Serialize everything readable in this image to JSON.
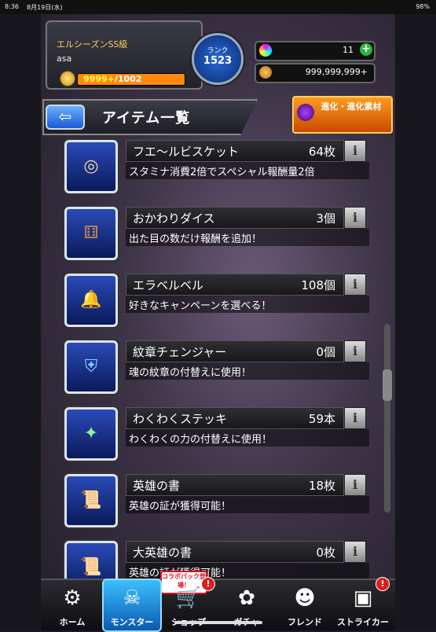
{
  "status": {
    "time": "8:36",
    "date": "8月19日(水)",
    "battery": "98%"
  },
  "header": {
    "season": "エルシーズンSS級",
    "username": "asa",
    "stamina_value": "9999+",
    "stamina_max": "/1002",
    "rank_label": "ランク",
    "rank_number": "1523",
    "orbs": "11",
    "gold": "999,999,999+",
    "plus": "+"
  },
  "titlebar": {
    "back": "⇦",
    "title": "アイテム一覧",
    "evolve_label": "進化・進化素材"
  },
  "items": [
    {
      "name": "フエ〜ルビスケット",
      "count": "64枚",
      "desc": "スタミナ消費2倍でスペシャル報酬量2倍",
      "glyph": "◎"
    },
    {
      "name": "おかわりダイス",
      "count": "3個",
      "desc": "出た目の数だけ報酬を追加！",
      "glyph": "⚅"
    },
    {
      "name": "エラベルベル",
      "count": "108個",
      "desc": "好きなキャンペーンを選べる！",
      "glyph": "🔔"
    },
    {
      "name": "紋章チェンジャー",
      "count": "0個",
      "desc": "魂の紋章の付替えに使用！",
      "glyph": "⛨"
    },
    {
      "name": "わくわくステッキ",
      "count": "59本",
      "desc": "わくわくの力の付替えに使用！",
      "glyph": "✦"
    },
    {
      "name": "英雄の書",
      "count": "18枚",
      "desc": "英雄の証が獲得可能！",
      "glyph": "📜"
    },
    {
      "name": "大英雄の書",
      "count": "0枚",
      "desc": "英雄の証が獲得可能！",
      "glyph": "📜"
    }
  ],
  "info_label": "i",
  "nav": [
    {
      "label": "ホーム",
      "icon": "home-icon",
      "glyph": "⚙"
    },
    {
      "label": "モンスター",
      "icon": "monster-icon",
      "glyph": "☠"
    },
    {
      "label": "ショップ",
      "icon": "cart-icon",
      "glyph": "🛒"
    },
    {
      "label": "ガチャ",
      "icon": "gacha-icon",
      "glyph": "✿"
    },
    {
      "label": "フレンド",
      "icon": "friends-icon",
      "glyph": "☻"
    },
    {
      "label": "ストライカー",
      "icon": "striker-icon",
      "glyph": "▣"
    }
  ],
  "collab_badge": "コラボパック登場！",
  "alert": "!",
  "colors": {
    "stamina": "#ff8a10",
    "active_tab": "#3ac0ff",
    "plus": "#2ab83a"
  }
}
